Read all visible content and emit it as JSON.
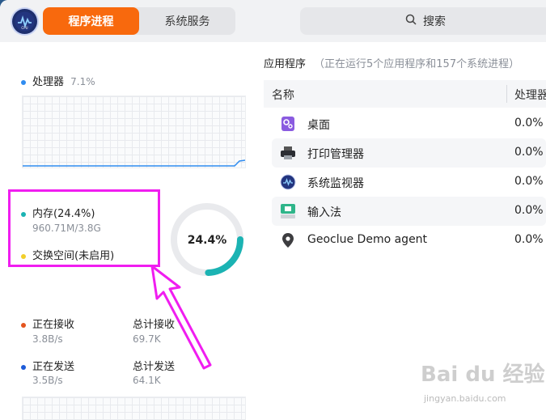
{
  "header": {
    "tabs": [
      {
        "label": "程序进程",
        "active": true
      },
      {
        "label": "系统服务",
        "active": false
      }
    ],
    "search_label": "搜索"
  },
  "colors": {
    "accent": "#f8690d",
    "memory": "#1bb3b3",
    "swap": "#f2cf2a",
    "cpu": "#2f8cf0",
    "recv": "#e4541e",
    "send": "#1d5bd8",
    "annotation": "#f01df0"
  },
  "cpu": {
    "label": "处理器",
    "value": "7.1%"
  },
  "memory": {
    "label": "内存(24.4%)",
    "detail": "960.71M/3.8G",
    "percent": 24.4,
    "ring_text": "24.4%"
  },
  "swap": {
    "label": "交换空间(未启用)"
  },
  "network": {
    "recv_label": "正在接收",
    "recv_value": "3.8B/s",
    "recv_total_label": "总计接收",
    "recv_total_value": "69.7K",
    "send_label": "正在发送",
    "send_value": "3.5B/s",
    "send_total_label": "总计发送",
    "send_total_value": "64.1K"
  },
  "apps": {
    "title": "应用程序",
    "subtitle": "（正在运行5个应用程序和157个系统进程）",
    "columns": [
      "名称",
      "处理器"
    ],
    "rows": [
      {
        "name": "桌面",
        "cpu": "0.0%",
        "icon": "desktop-gear-icon"
      },
      {
        "name": "打印管理器",
        "cpu": "0.0%",
        "icon": "printer-icon"
      },
      {
        "name": "系统监视器",
        "cpu": "0.0%",
        "icon": "system-monitor-icon"
      },
      {
        "name": "输入法",
        "cpu": "0.0%",
        "icon": "input-method-icon"
      },
      {
        "name": "Geoclue Demo agent",
        "cpu": "0.0%",
        "icon": "location-pin-icon"
      }
    ]
  },
  "watermark": {
    "brand": "Bai du 经验",
    "url": "jingyan.baidu.com"
  }
}
